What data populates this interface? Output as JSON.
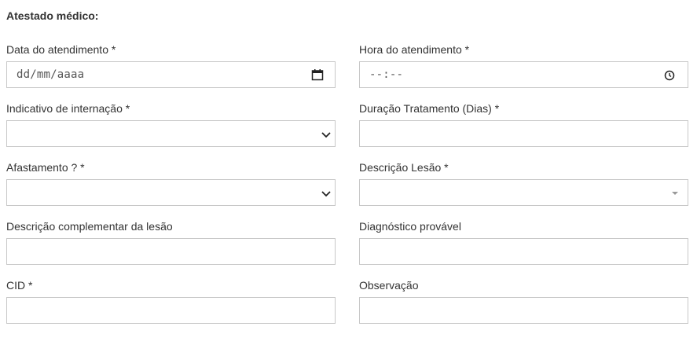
{
  "form": {
    "title": "Atestado médico:",
    "fields": {
      "data_atendimento": {
        "label": "Data do atendimento *",
        "placeholder": "dd/mm/aaaa"
      },
      "hora_atendimento": {
        "label": "Hora do atendimento *",
        "placeholder": "--:--"
      },
      "indicativo_internacao": {
        "label": "Indicativo de internação *",
        "value": ""
      },
      "duracao_tratamento": {
        "label": "Duração Tratamento (Dias) *",
        "value": ""
      },
      "afastamento": {
        "label": "Afastamento ? *",
        "value": ""
      },
      "descricao_lesao": {
        "label": "Descrição Lesão *",
        "value": ""
      },
      "descricao_complementar": {
        "label": "Descrição complementar da lesão",
        "value": ""
      },
      "diagnostico_provavel": {
        "label": "Diagnóstico provável",
        "value": ""
      },
      "cid": {
        "label": "CID *",
        "value": ""
      },
      "observacao": {
        "label": "Observação",
        "value": ""
      }
    }
  },
  "icons": {
    "date": "calendar-icon",
    "time": "clock-icon",
    "select": "chevron-down-icon",
    "combo": "caret-down-icon"
  },
  "colors": {
    "border": "#c8c8c8",
    "text": "#333333",
    "background": "#ffffff"
  }
}
